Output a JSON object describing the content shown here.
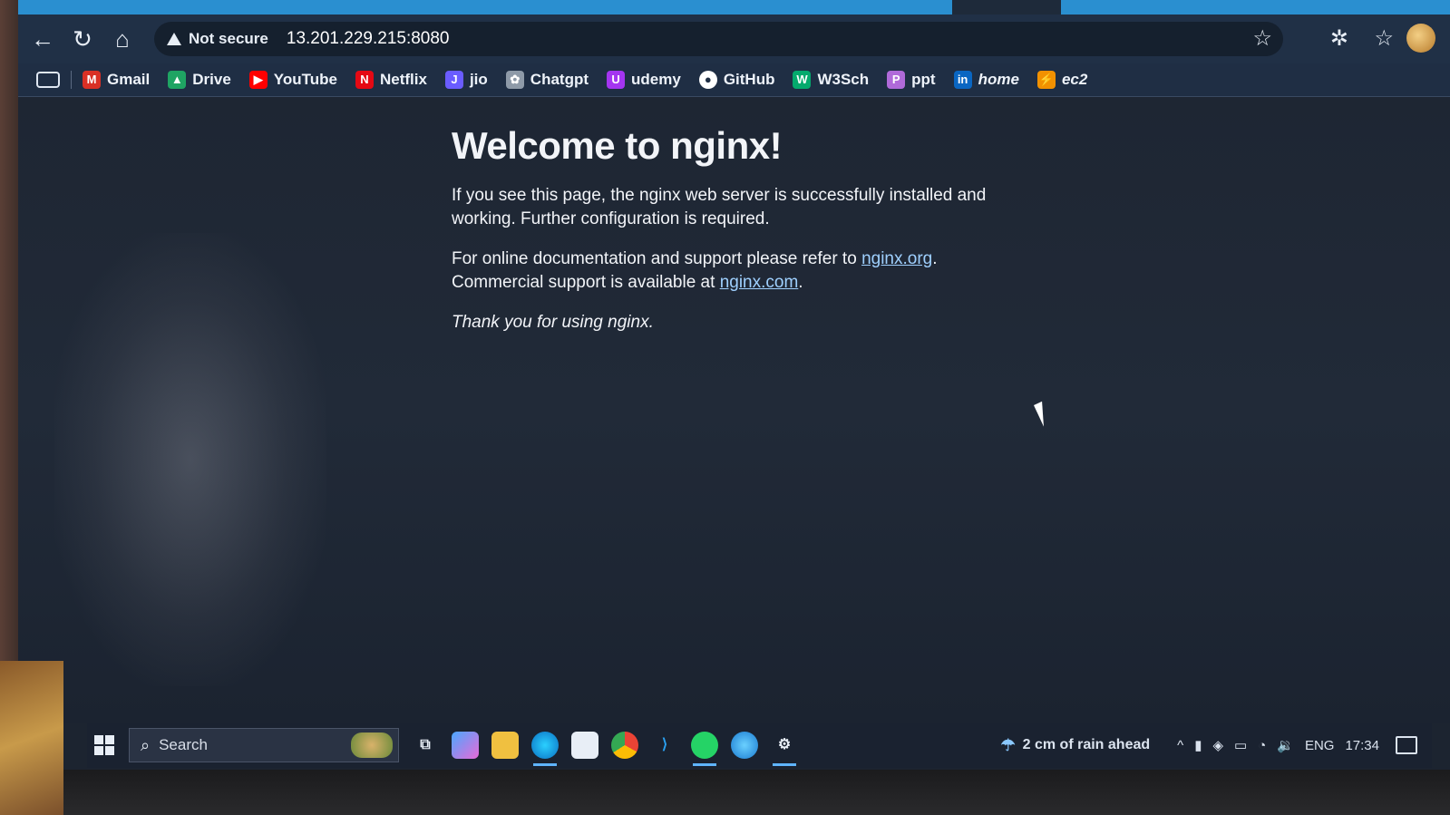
{
  "browser": {
    "security_label": "Not secure",
    "url": "13.201.229.215:8080"
  },
  "bookmarks": [
    {
      "label": "Gmail",
      "icon": "gmail-icon",
      "color": "#d93025",
      "glyph": "M"
    },
    {
      "label": "Drive",
      "icon": "drive-icon",
      "color": "#1fa463",
      "glyph": "▲"
    },
    {
      "label": "YouTube",
      "icon": "youtube-icon",
      "color": "#ff0000",
      "glyph": "▶"
    },
    {
      "label": "Netflix",
      "icon": "netflix-icon",
      "color": "#e50914",
      "glyph": "N"
    },
    {
      "label": "jio",
      "icon": "jio-icon",
      "color": "#6a5cff",
      "glyph": "J"
    },
    {
      "label": "Chatgpt",
      "icon": "chatgpt-icon",
      "color": "#8e9aa8",
      "glyph": "✿"
    },
    {
      "label": "udemy",
      "icon": "udemy-icon",
      "color": "#a435f0",
      "glyph": "U"
    },
    {
      "label": "GitHub",
      "icon": "github-icon",
      "color": "#ffffff",
      "glyph": "●"
    },
    {
      "label": "W3Sch",
      "icon": "w3schools-icon",
      "color": "#04aa6d",
      "glyph": "W"
    },
    {
      "label": "ppt",
      "icon": "ppt-icon",
      "color": "#b06ad9",
      "glyph": "P"
    },
    {
      "label": "home",
      "icon": "linkedin-icon",
      "color": "#0a66c2",
      "glyph": "in"
    },
    {
      "label": "ec2",
      "icon": "ec2-icon",
      "color": "#f29100",
      "glyph": "⚡"
    }
  ],
  "page": {
    "title": "Welcome to nginx!",
    "para1": "If you see this page, the nginx web server is successfully installed and working. Further configuration is required.",
    "para2_prefix": "For online documentation and support please refer to ",
    "link1": "nginx.org",
    "para2_mid": ".",
    "para3_prefix": "Commercial support is available at ",
    "link2": "nginx.com",
    "para3_suffix": ".",
    "thanks": "Thank you for using nginx."
  },
  "taskbar": {
    "search_label": "Search",
    "weather": "2 cm of rain ahead",
    "language": "ENG",
    "time": "17:34"
  },
  "colors": {
    "tabstrip": "#2a8fd0",
    "link": "#9fd0ff"
  }
}
